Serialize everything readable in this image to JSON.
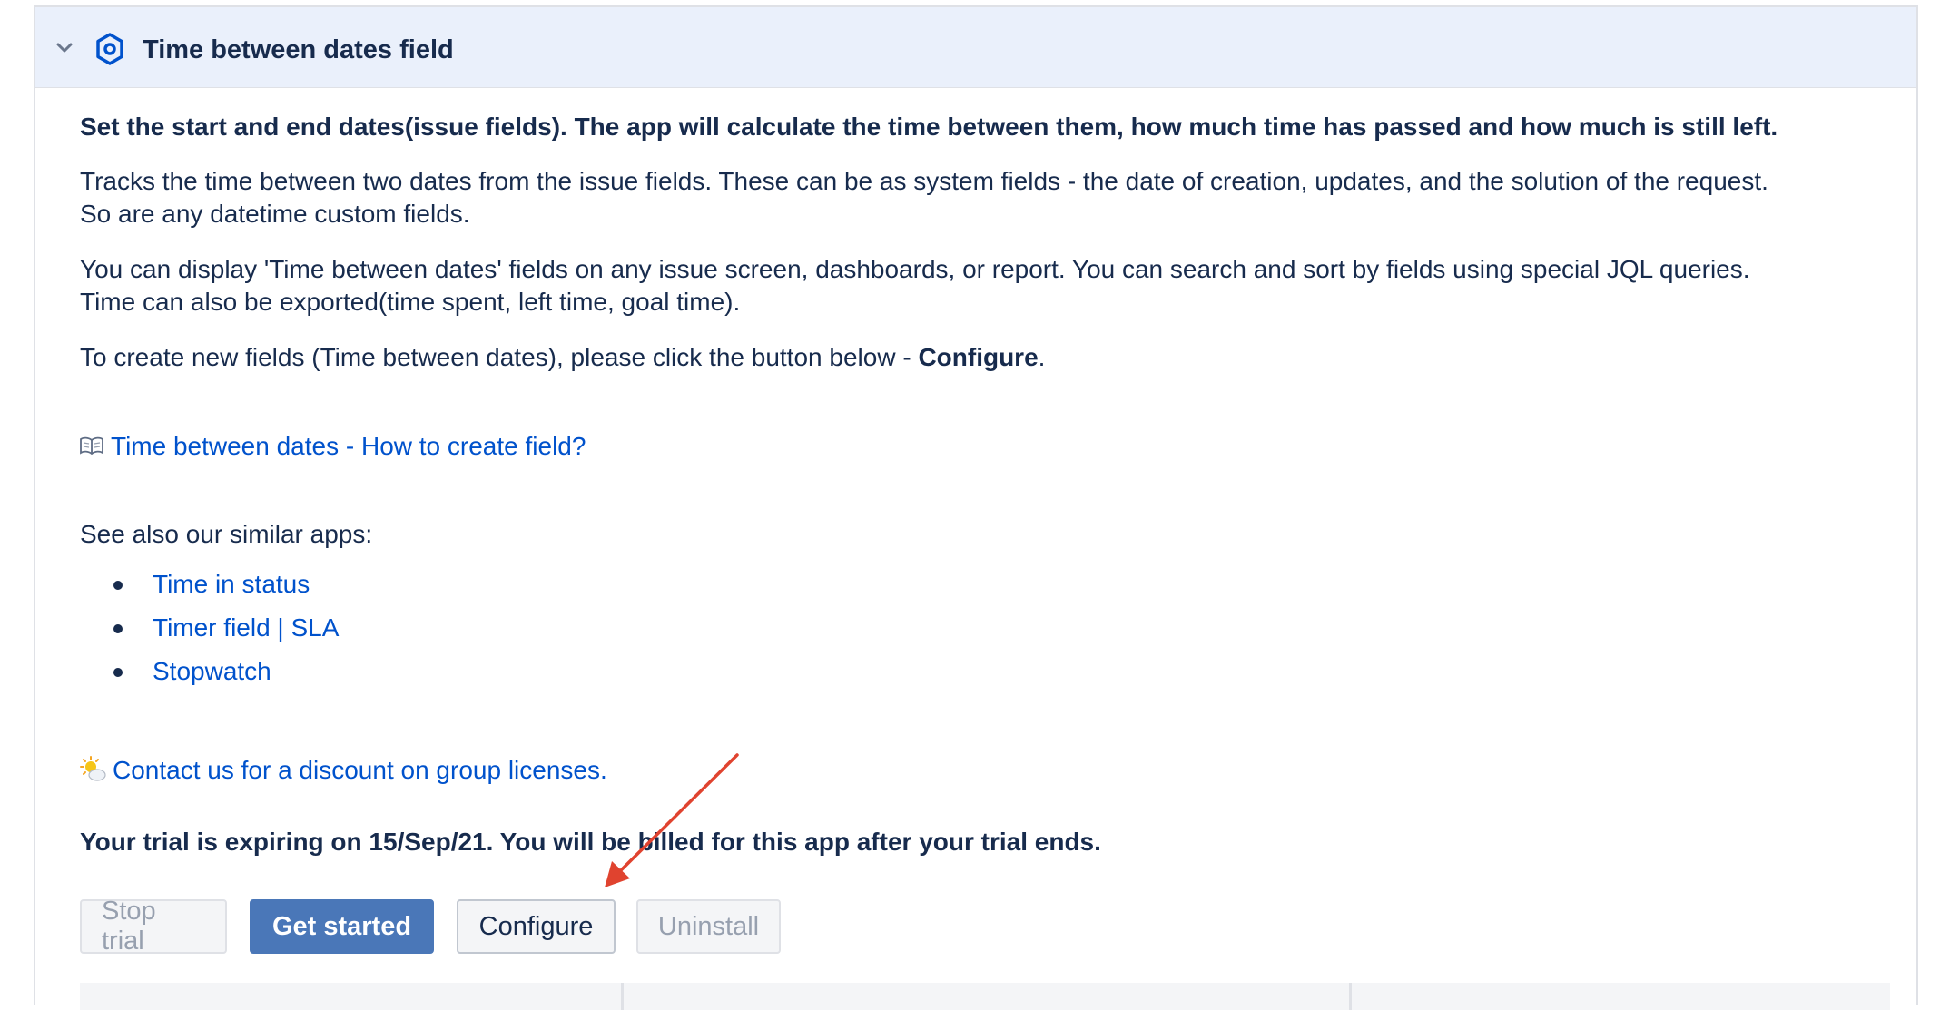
{
  "header": {
    "title": "Time between dates field",
    "chevron_icon": "chevron-down-icon",
    "app_icon": "hexagon-app-icon"
  },
  "content": {
    "lead": "Set the start and end dates(issue fields). The app will calculate the time between them, how much time has passed and how much is still left.",
    "p1_line1": "Tracks the time between two dates from the issue fields. These can be as system fields - the date of creation, updates, and the solution of the request.",
    "p1_line2": "So are any datetime custom fields.",
    "p2_line1": "You can display 'Time between dates' fields on any issue screen, dashboards, or report. You can search and sort by fields using special JQL queries.",
    "p2_line2": "Time can also be exported(time spent, left time, goal time).",
    "p3_prefix": "To create new fields (Time between dates), please click the button below - ",
    "p3_bold": "Configure",
    "p3_suffix": ".",
    "howto_link": "Time between dates - How to create field?",
    "see_also": "See also our similar apps:",
    "apps": [
      "Time in status",
      "Timer field | SLA",
      "Stopwatch"
    ],
    "contact_link": "Contact us for a discount on group licenses.",
    "trial_notice": "Your trial is expiring on 15/Sep/21. You will be billed for this app after your trial ends."
  },
  "buttons": {
    "stop_trial": "Stop trial",
    "get_started": "Get started",
    "configure": "Configure",
    "uninstall": "Uninstall"
  },
  "colors": {
    "header_bg": "#eaf0fb",
    "link": "#0052cc",
    "primary_button": "#4a77b8",
    "annotation_arrow": "#e0432f"
  }
}
